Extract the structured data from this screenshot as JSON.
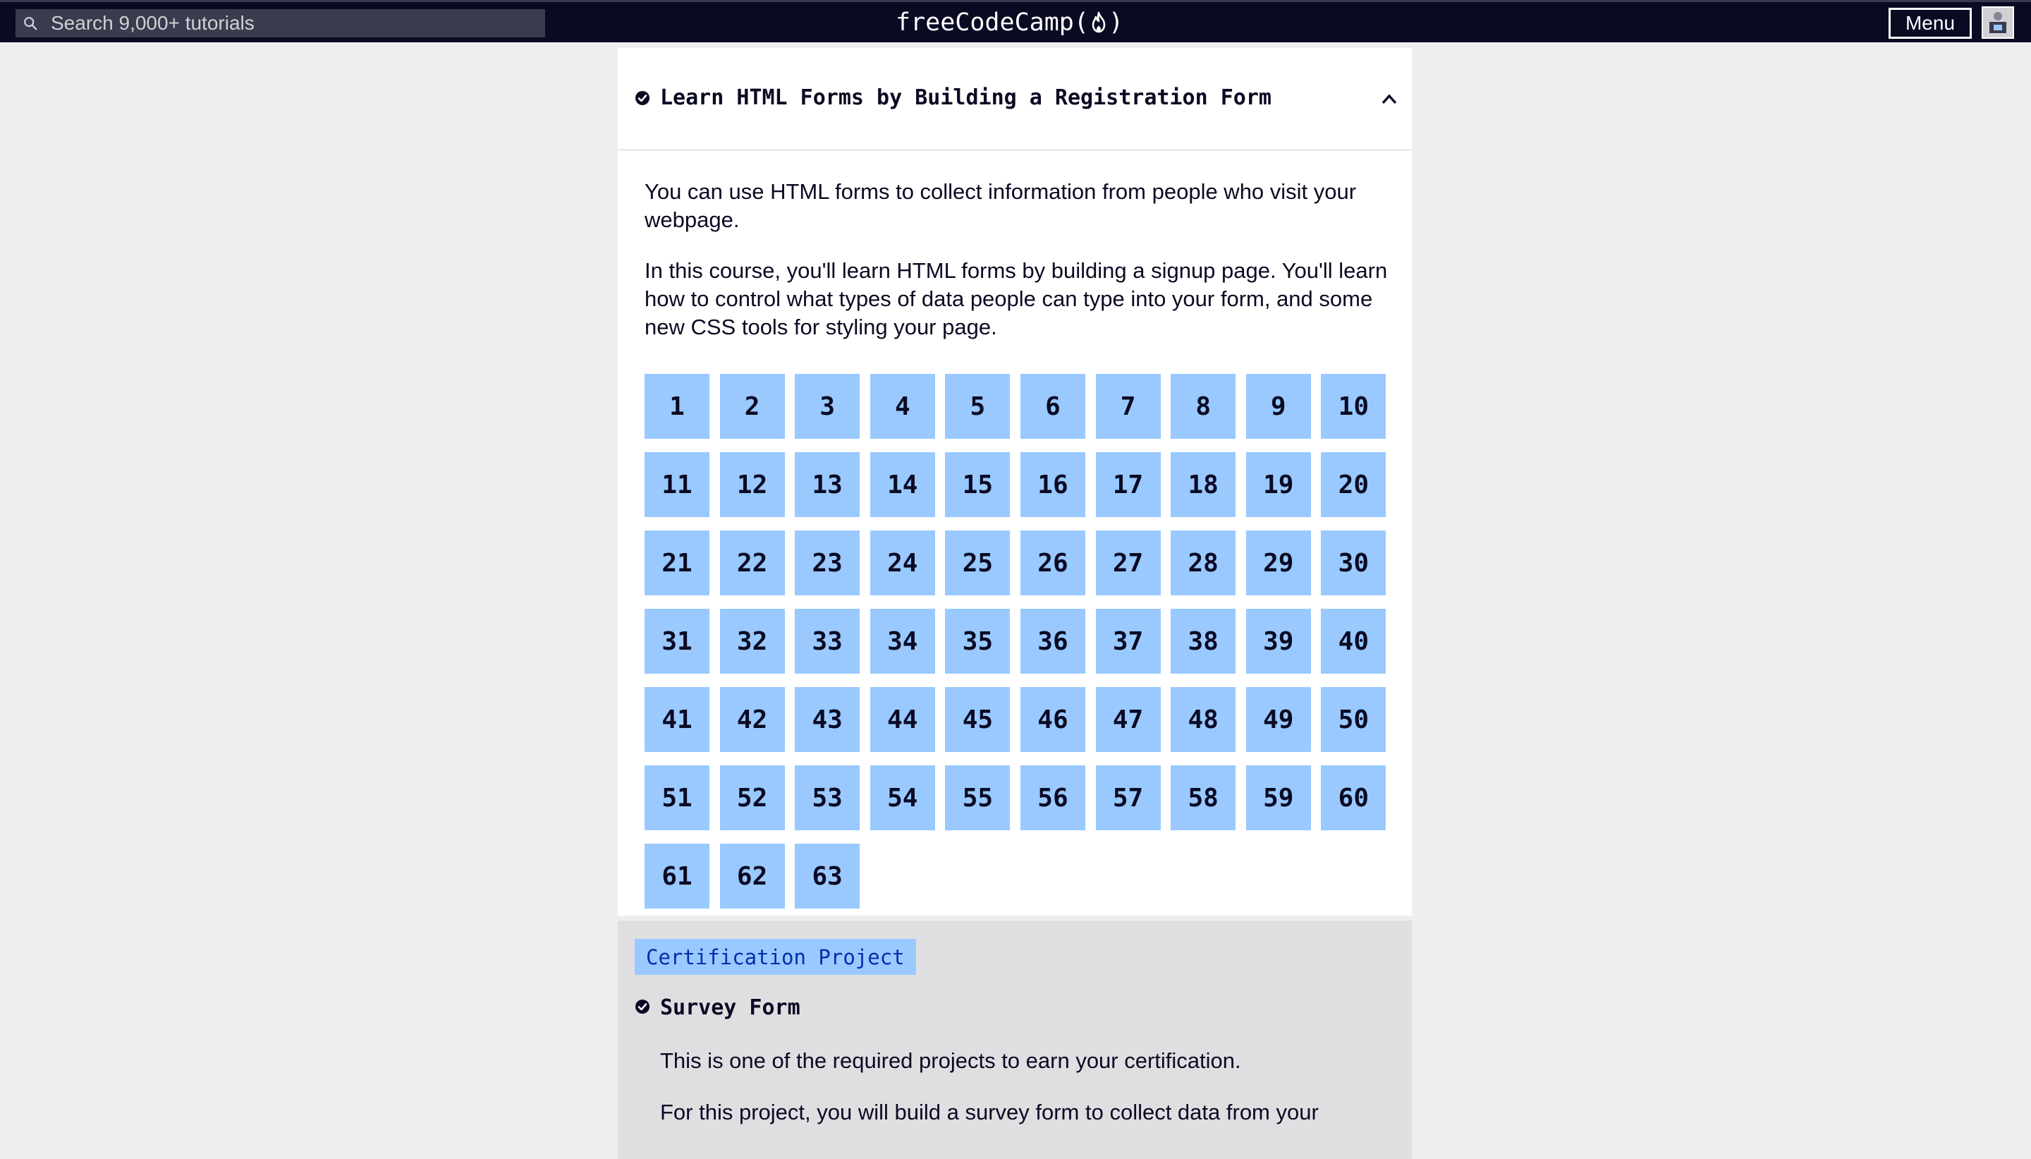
{
  "nav": {
    "search_placeholder": "Search 9,000+ tutorials",
    "brand_prefix": "freeCodeCamp(",
    "brand_suffix": ")",
    "menu_label": "Menu"
  },
  "course": {
    "title": "Learn HTML Forms by Building a Registration Form",
    "completed": true,
    "expanded": true,
    "paragraphs": [
      "You can use HTML forms to collect information from people who visit your webpage.",
      "In this course, you'll learn HTML forms by building a signup page. You'll learn how to control what types of data people can type into your form, and some new CSS tools for styling your page."
    ],
    "steps": [
      "1",
      "2",
      "3",
      "4",
      "5",
      "6",
      "7",
      "8",
      "9",
      "10",
      "11",
      "12",
      "13",
      "14",
      "15",
      "16",
      "17",
      "18",
      "19",
      "20",
      "21",
      "22",
      "23",
      "24",
      "25",
      "26",
      "27",
      "28",
      "29",
      "30",
      "31",
      "32",
      "33",
      "34",
      "35",
      "36",
      "37",
      "38",
      "39",
      "40",
      "41",
      "42",
      "43",
      "44",
      "45",
      "46",
      "47",
      "48",
      "49",
      "50",
      "51",
      "52",
      "53",
      "54",
      "55",
      "56",
      "57",
      "58",
      "59",
      "60",
      "61",
      "62",
      "63"
    ]
  },
  "project": {
    "badge": "Certification Project",
    "title": "Survey Form",
    "completed": true,
    "paragraphs": [
      "This is one of the required projects to earn your certification.",
      "For this project, you will build a survey form to collect data from your"
    ]
  },
  "colors": {
    "nav_bg": "#0a0a23",
    "page_bg": "#eeeef0",
    "step_bg": "#99c9ff",
    "project_bg": "#dfdfe2",
    "badge_text": "#002ead"
  },
  "icons": {
    "search": "search-icon",
    "flame": "flame-icon",
    "check": "check-circle-icon",
    "chevron": "chevron-up-icon",
    "avatar": "avatar-icon"
  }
}
